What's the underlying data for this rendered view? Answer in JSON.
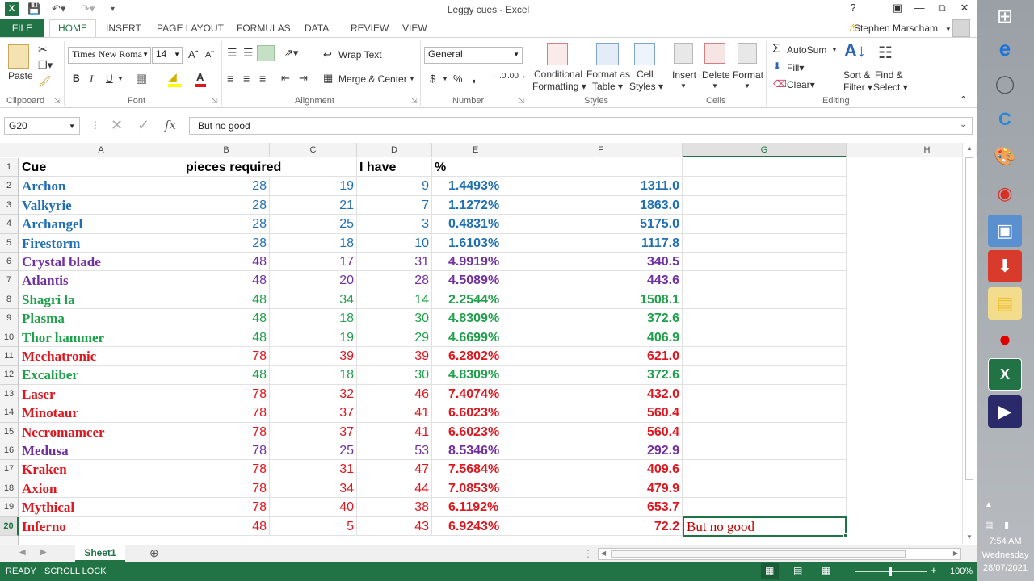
{
  "window": {
    "title": "Leggy cues - Excel"
  },
  "ribbon": {
    "tabs": [
      "FILE",
      "HOME",
      "INSERT",
      "PAGE LAYOUT",
      "FORMULAS",
      "DATA",
      "REVIEW",
      "VIEW"
    ],
    "user": "Stephen Marscham",
    "clipboard": {
      "paste": "Paste",
      "label": "Clipboard"
    },
    "font": {
      "name": "Times New Roma",
      "size": "14",
      "bold": "B",
      "italic": "I",
      "underline": "U",
      "label": "Font"
    },
    "alignment": {
      "wrap": "Wrap Text",
      "merge": "Merge & Center",
      "label": "Alignment"
    },
    "number": {
      "format": "General",
      "currency": "$",
      "percent": "%",
      "comma": ",",
      "label": "Number"
    },
    "styles": {
      "conditional": "Conditional",
      "conditional2": "Formatting",
      "format_as": "Format as",
      "format_as2": "Table",
      "cell_styles": "Cell",
      "cell_styles2": "Styles",
      "label": "Styles"
    },
    "cells": {
      "insert": "Insert",
      "delete": "Delete",
      "format": "Format",
      "label": "Cells"
    },
    "editing": {
      "autosum": "AutoSum",
      "fill": "Fill",
      "clear": "Clear",
      "sort": "Sort &",
      "sort2": "Filter",
      "find": "Find &",
      "find2": "Select",
      "label": "Editing"
    }
  },
  "formula_bar": {
    "name_box": "G20",
    "content": "But no good"
  },
  "sheet": {
    "columns": [
      "A",
      "B",
      "C",
      "D",
      "E",
      "F",
      "G",
      "H"
    ],
    "header_row": {
      "a": "Cue",
      "b": "pieces required",
      "d": "I have",
      "e": "%"
    },
    "rows": [
      {
        "n": "2",
        "cue": "Archon",
        "b": "28",
        "c": "19",
        "d": "9",
        "e": "1.4493%",
        "f": "1311.0",
        "color": "#1f6fb2"
      },
      {
        "n": "3",
        "cue": "Valkyrie",
        "b": "28",
        "c": "21",
        "d": "7",
        "e": "1.1272%",
        "f": "1863.0",
        "color": "#1f6fb2"
      },
      {
        "n": "4",
        "cue": "Archangel",
        "b": "28",
        "c": "25",
        "d": "3",
        "e": "0.4831%",
        "f": "5175.0",
        "color": "#1f6fb2"
      },
      {
        "n": "5",
        "cue": "Firestorm",
        "b": "28",
        "c": "18",
        "d": "10",
        "e": "1.6103%",
        "f": "1117.8",
        "color": "#1f6fb2"
      },
      {
        "n": "6",
        "cue": "Crystal blade",
        "b": "48",
        "c": "17",
        "d": "31",
        "e": "4.9919%",
        "f": "340.5",
        "color": "#7030a0"
      },
      {
        "n": "7",
        "cue": "Atlantis",
        "b": "48",
        "c": "20",
        "d": "28",
        "e": "4.5089%",
        "f": "443.6",
        "color": "#7030a0"
      },
      {
        "n": "8",
        "cue": "Shagri la",
        "b": "48",
        "c": "34",
        "d": "14",
        "e": "2.2544%",
        "f": "1508.1",
        "color": "#1fa04a"
      },
      {
        "n": "9",
        "cue": "Plasma",
        "b": "48",
        "c": "18",
        "d": "30",
        "e": "4.8309%",
        "f": "372.6",
        "color": "#1fa04a"
      },
      {
        "n": "10",
        "cue": "Thor hammer",
        "b": "48",
        "c": "19",
        "d": "29",
        "e": "4.6699%",
        "f": "406.9",
        "color": "#1fa04a"
      },
      {
        "n": "11",
        "cue": "Mechatronic",
        "b": "78",
        "c": "39",
        "d": "39",
        "e": "6.2802%",
        "f": "621.0",
        "color": "#e0161e"
      },
      {
        "n": "12",
        "cue": "Excaliber",
        "b": "48",
        "c": "18",
        "d": "30",
        "e": "4.8309%",
        "f": "372.6",
        "color": "#1fa04a"
      },
      {
        "n": "13",
        "cue": "Laser",
        "b": "78",
        "c": "32",
        "d": "46",
        "e": "7.4074%",
        "f": "432.0",
        "color": "#e0161e"
      },
      {
        "n": "14",
        "cue": "Minotaur",
        "b": "78",
        "c": "37",
        "d": "41",
        "e": "6.6023%",
        "f": "560.4",
        "color": "#e0161e"
      },
      {
        "n": "15",
        "cue": "Necromamcer",
        "b": "78",
        "c": "37",
        "d": "41",
        "e": "6.6023%",
        "f": "560.4",
        "color": "#e0161e"
      },
      {
        "n": "16",
        "cue": "Medusa",
        "b": "78",
        "c": "25",
        "d": "53",
        "e": "8.5346%",
        "f": "292.9",
        "color": "#7030a0"
      },
      {
        "n": "17",
        "cue": "Kraken",
        "b": "78",
        "c": "31",
        "d": "47",
        "e": "7.5684%",
        "f": "409.6",
        "color": "#e0161e"
      },
      {
        "n": "18",
        "cue": "Axion",
        "b": "78",
        "c": "34",
        "d": "44",
        "e": "7.0853%",
        "f": "479.9",
        "color": "#e0161e"
      },
      {
        "n": "19",
        "cue": "Mythical",
        "b": "78",
        "c": "40",
        "d": "38",
        "e": "6.1192%",
        "f": "653.7",
        "color": "#e0161e"
      },
      {
        "n": "20",
        "cue": "Inferno",
        "b": "48",
        "c": "5",
        "d": "43",
        "e": "6.9243%",
        "f": "72.2",
        "color": "#e0161e"
      }
    ],
    "g20": "But no good"
  },
  "sheet_tab": "Sheet1",
  "status": {
    "ready": "READY",
    "scroll_lock": "SCROLL LOCK",
    "zoom": "100%"
  },
  "taskbar": {
    "time": "7:54 AM",
    "day": "Wednesday",
    "date": "28/07/2021"
  }
}
